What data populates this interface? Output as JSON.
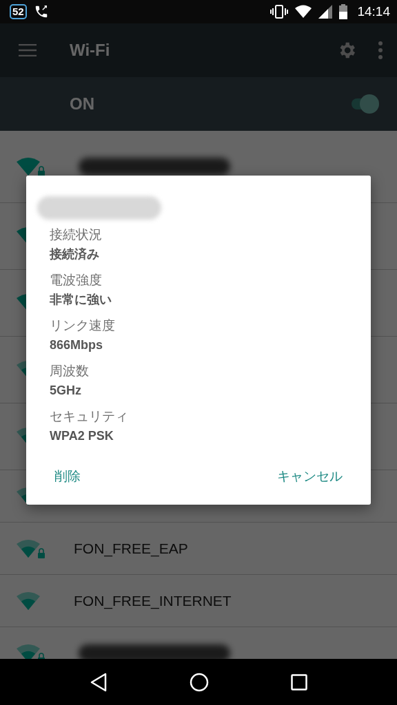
{
  "status_bar": {
    "badge": "52",
    "time": "14:14"
  },
  "toolbar": {
    "title": "Wi-Fi"
  },
  "switch_bar": {
    "label": "ON",
    "on": true
  },
  "networks": [
    {
      "name_blurred": true,
      "locked": true,
      "kind": "strong"
    },
    {
      "kind": "strong"
    },
    {
      "kind": "strong"
    },
    {
      "kind": "medium"
    },
    {
      "kind": "medium"
    },
    {
      "kind": "medium"
    },
    {
      "name": "FON_FREE_EAP",
      "locked": true,
      "kind": "medium"
    },
    {
      "name": "FON_FREE_INTERNET",
      "locked": false,
      "kind": "medium"
    },
    {
      "name_blurred": true,
      "locked": true,
      "kind": "medium"
    }
  ],
  "dialog": {
    "title_blurred": true,
    "fields": [
      {
        "label": "接続状況",
        "value": "接続済み"
      },
      {
        "label": "電波強度",
        "value": "非常に強い"
      },
      {
        "label": "リンク速度",
        "value": "866Mbps"
      },
      {
        "label": "周波数",
        "value": "5GHz"
      },
      {
        "label": "セキュリティ",
        "value": "WPA2 PSK"
      }
    ],
    "buttons": [
      {
        "label": "削除"
      },
      {
        "label": "キャンセル"
      }
    ]
  }
}
